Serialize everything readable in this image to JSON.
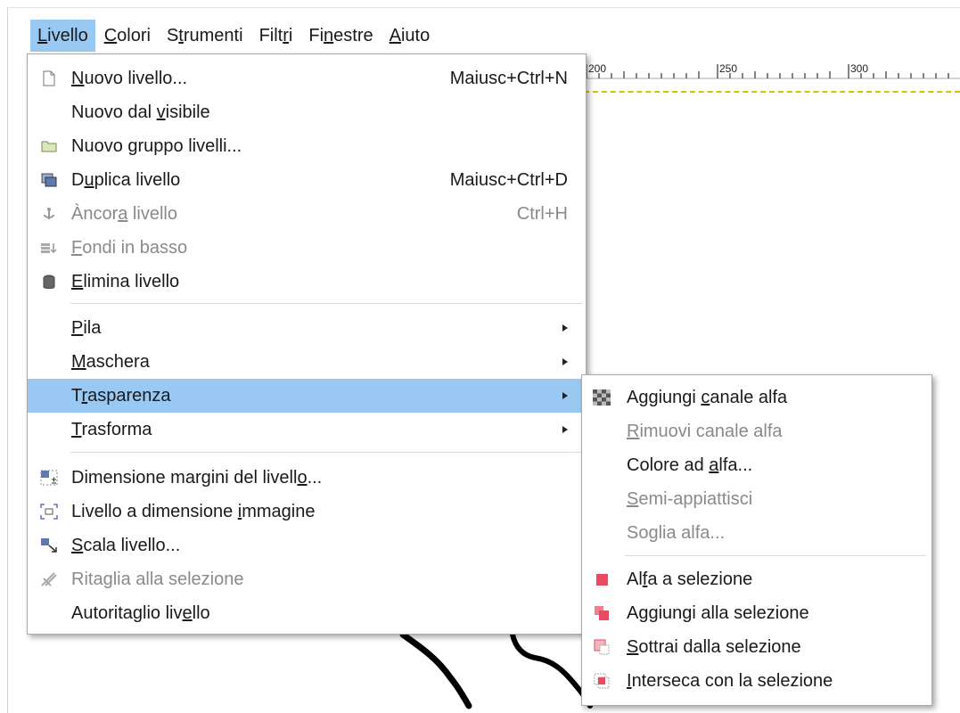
{
  "menubar": {
    "items": [
      {
        "pre": "",
        "ul": "L",
        "post": "ivello",
        "active": true
      },
      {
        "pre": "",
        "ul": "C",
        "post": "olori"
      },
      {
        "pre": "S",
        "ul": "t",
        "post": "rumenti"
      },
      {
        "pre": "Filt",
        "ul": "r",
        "post": "i"
      },
      {
        "pre": "Fi",
        "ul": "n",
        "post": "estre"
      },
      {
        "pre": "",
        "ul": "A",
        "post": "iuto"
      }
    ]
  },
  "ruler": {
    "ticks": [
      "200",
      "250",
      "300"
    ]
  },
  "livello_menu": {
    "items": [
      {
        "pre": "",
        "ul": "N",
        "post": "uovo livello...",
        "shortcut": "Maiusc+Ctrl+N",
        "icon": "new-layer-icon"
      },
      {
        "pre": "Nuovo dal ",
        "ul": "v",
        "post": "isibile",
        "shortcut": "",
        "icon": ""
      },
      {
        "pre": "Nuovo ",
        "ul": "g",
        "post": "ruppo livelli...",
        "shortcut": "",
        "icon": "folder-icon"
      },
      {
        "pre": "D",
        "ul": "u",
        "post": "plica livello",
        "shortcut": "Maiusc+Ctrl+D",
        "icon": "duplicate-icon"
      },
      {
        "pre": "Àncor",
        "ul": "a",
        "post": " livello",
        "shortcut": "Ctrl+H",
        "icon": "anchor-icon",
        "disabled": true
      },
      {
        "pre": "",
        "ul": "F",
        "post": "ondi in basso",
        "shortcut": "",
        "icon": "merge-down-icon",
        "disabled": true
      },
      {
        "pre": "",
        "ul": "E",
        "post": "limina livello",
        "shortcut": "",
        "icon": "trash-icon"
      },
      {
        "pre": "",
        "ul": "P",
        "post": "ila",
        "submenu": true
      },
      {
        "pre": "",
        "ul": "M",
        "post": "aschera",
        "submenu": true
      },
      {
        "pre": "T",
        "ul": "r",
        "post": "asparenza",
        "submenu": true,
        "highlighted": true
      },
      {
        "pre": "",
        "ul": "T",
        "post": "rasforma",
        "submenu": true
      },
      {
        "pre": "Dimensione margini del livell",
        "ul": "o",
        "post": "...",
        "icon": "layer-boundary-icon"
      },
      {
        "pre": "Livello a dimensione ",
        "ul": "i",
        "post": "mmagine",
        "icon": "layer-to-image-icon"
      },
      {
        "pre": "",
        "ul": "S",
        "post": "cala livello...",
        "icon": "scale-layer-icon"
      },
      {
        "pre": "Rita",
        "ul": "g",
        "post": "lia alla selezione",
        "icon": "crop-icon",
        "disabled": true
      },
      {
        "pre": "Autoritaglio liv",
        "ul": "e",
        "post": "llo",
        "icon": ""
      }
    ]
  },
  "trasparenza_menu": {
    "items": [
      {
        "pre": "Aggiungi ",
        "ul": "c",
        "post": "anale alfa",
        "icon": "checker-icon"
      },
      {
        "pre": "",
        "ul": "R",
        "post": "imuovi canale alfa",
        "disabled": true
      },
      {
        "pre": "Colore ad ",
        "ul": "a",
        "post": "lfa..."
      },
      {
        "pre": "",
        "ul": "S",
        "post": "emi-appiattisci",
        "disabled": true
      },
      {
        "pre": "So",
        "ul": "g",
        "post": "lia alfa...",
        "disabled": true
      },
      {
        "pre": "Al",
        "ul": "f",
        "post": "a a selezione",
        "icon": "alpha-selection-icon"
      },
      {
        "pre": "Aggiungi alla selezione",
        "ul": "",
        "post": "",
        "icon": "add-selection-icon"
      },
      {
        "pre": "",
        "ul": "S",
        "post": "ottrai dalla selezione",
        "icon": "subtract-selection-icon"
      },
      {
        "pre": "",
        "ul": "I",
        "post": "nterseca con la selezione",
        "icon": "intersect-selection-icon"
      }
    ]
  },
  "colors": {
    "highlight": "#99c9f3",
    "disabled_text": "#8a8a8a",
    "guide_dash": "#d8c200"
  }
}
